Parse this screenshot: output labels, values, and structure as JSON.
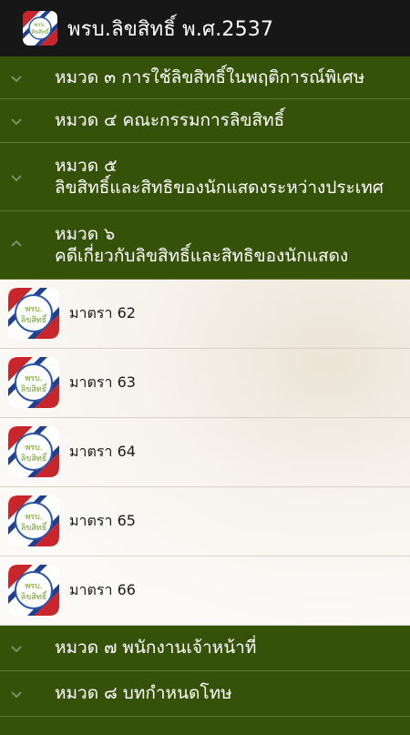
{
  "app": {
    "title": "พรบ.ลิขสิทธิ์ พ.ศ.2537",
    "logo_text_line1": "พรบ.",
    "logo_text_line2": "ลิขสิทธิ์"
  },
  "colors": {
    "appbar": "#171717",
    "group_bg": "#365209",
    "divider": "#5f7a35"
  },
  "groups_top": [
    {
      "label": "หมวด ๓ การใช้ลิขสิทธิ์ในพฤติการณ์พิเศษ",
      "icon": "chevron-down-icon"
    },
    {
      "label": "หมวด ๔ คณะกรรมการลิขสิทธิ์",
      "icon": "chevron-down-icon"
    },
    {
      "label_line1": "หมวด ๕",
      "label_line2": "ลิขสิทธิ์และสิทธิของนักแสดงระหว่างประเทศ",
      "icon": "chevron-down-icon"
    },
    {
      "label_line1": "หมวด ๖",
      "label_line2": "คดีเกี่ยวกับลิขสิทธิ์และสิทธิของนักแสดง",
      "icon": "chevron-up-icon",
      "expanded": true
    }
  ],
  "items": [
    {
      "label": "มาตรา 62"
    },
    {
      "label": "มาตรา 63"
    },
    {
      "label": "มาตรา 64"
    },
    {
      "label": "มาตรา 65"
    },
    {
      "label": "มาตรา 66"
    }
  ],
  "groups_bottom": [
    {
      "label": "หมวด ๗ พนักงานเจ้าหน้าที่",
      "icon": "chevron-down-icon"
    },
    {
      "label": "หมวด ๘ บทกำหนดโทษ",
      "icon": "chevron-down-icon"
    }
  ]
}
